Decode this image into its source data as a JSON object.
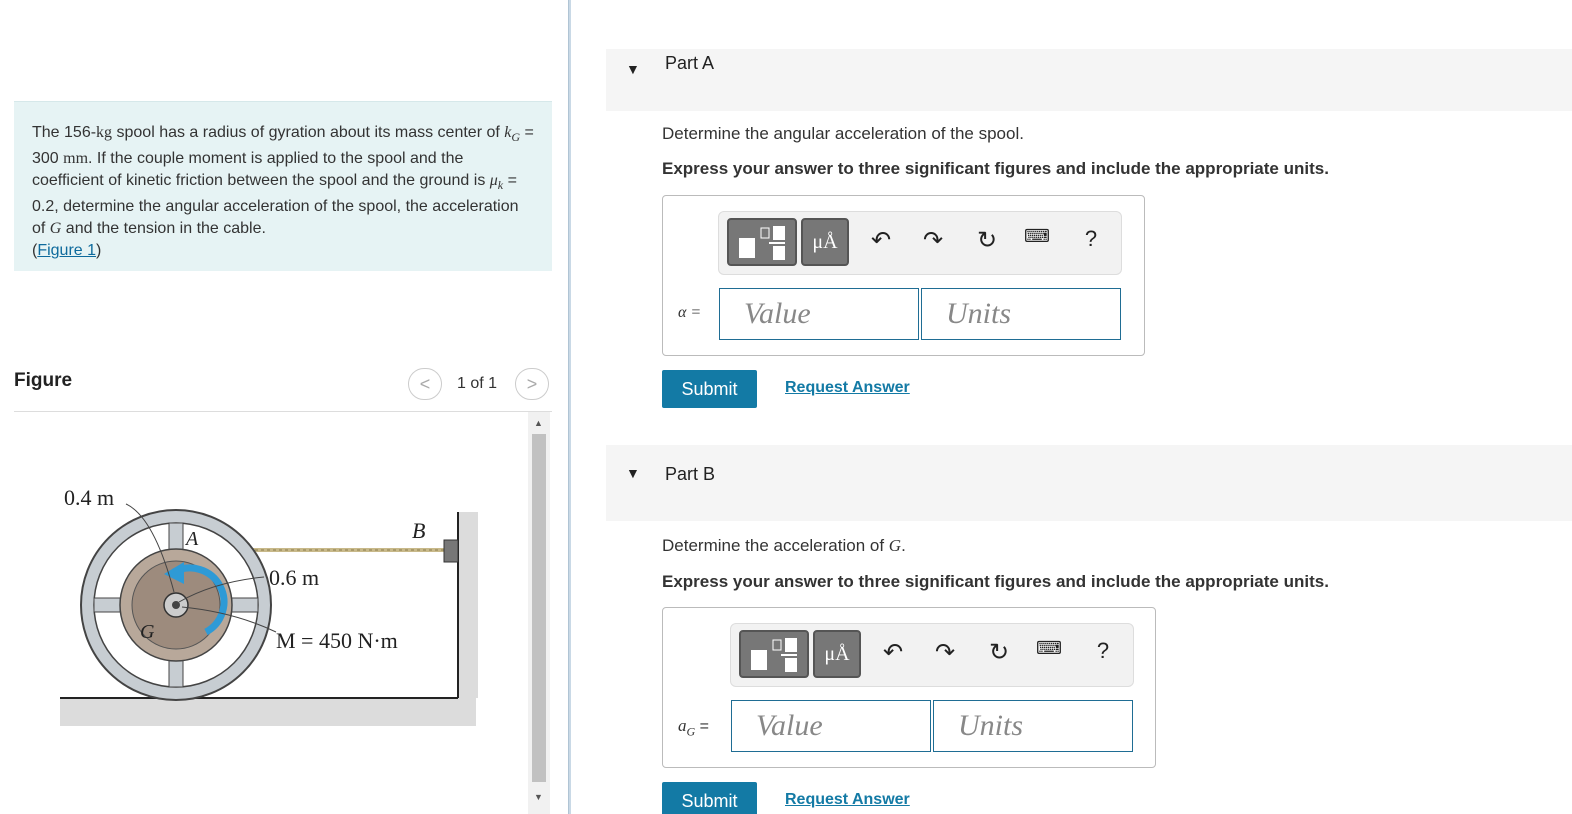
{
  "problem": {
    "t1": "The 156-",
    "t_kg": "kg",
    "t2": " spool has a radius of gyration about its mass center of ",
    "k": "k",
    "kG_sub": "G",
    "t3": " = 300 ",
    "mm": "mm",
    "t4": ". If the couple moment is applied to the spool and the coefficient of kinetic friction between the spool and the ground is ",
    "mu": "μ",
    "mu_sub": "k",
    "t5": " = 0.2, determine the angular acceleration of the spool, the acceleration of ",
    "G": "G",
    "t6": " and the tension in the cable.",
    "link_open": "(",
    "link": "Figure 1",
    "link_close": ")"
  },
  "figure": {
    "title": "Figure",
    "prev": "<",
    "next": ">",
    "pager": "1 of 1",
    "labels": {
      "r_outer": "0.4 m",
      "r_inner": "0.6 m",
      "A": "A",
      "B": "B",
      "G": "G",
      "moment": "M = 450 N·m"
    }
  },
  "partA": {
    "title": "Part A",
    "question": "Determine the angular acceleration of the spool.",
    "instruction": "Express your answer to three significant figures and include the appropriate units.",
    "label": "α =",
    "value_placeholder": "Value",
    "units_placeholder": "Units",
    "submit": "Submit",
    "request": "Request Answer",
    "mu_button": "μÅ",
    "help": "?"
  },
  "partB": {
    "title": "Part B",
    "question_pre": "Determine the acceleration of ",
    "question_var": "G",
    "question_post": ".",
    "instruction": "Express your answer to three significant figures and include the appropriate units.",
    "label_a": "a",
    "label_sub": "G",
    "label_eq": " =",
    "value_placeholder": "Value",
    "units_placeholder": "Units",
    "submit": "Submit",
    "request": "Request Answer",
    "mu_button": "μÅ",
    "help": "?"
  }
}
